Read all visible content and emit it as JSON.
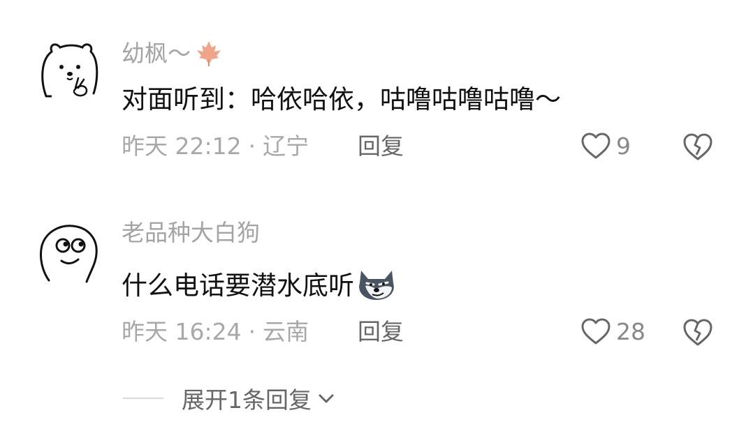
{
  "comments": [
    {
      "username": "幼枫～",
      "username_suffix_icon": "maple-leaf-icon",
      "text": "对面听到：哈依哈依，咕噜咕噜咕噜～",
      "time": "昨天 22:12",
      "separator": "·",
      "location": "辽宁",
      "reply_label": "回复",
      "likes": "9",
      "avatar_icon": "bear-waving-avatar"
    },
    {
      "username": "老品种大白狗",
      "text": "什么电话要潜水底听",
      "text_emoji": "wolf-smirk-emoji",
      "time": "昨天 16:24",
      "separator": "·",
      "location": "云南",
      "reply_label": "回复",
      "likes": "28",
      "avatar_icon": "doodle-face-avatar"
    }
  ],
  "expand_replies": {
    "label": "展开1条回复",
    "icon": "chevron-down-icon"
  },
  "colors": {
    "username": "#a4a4a4",
    "meta": "#a8a8a8",
    "leaf": "#f0a48a"
  }
}
